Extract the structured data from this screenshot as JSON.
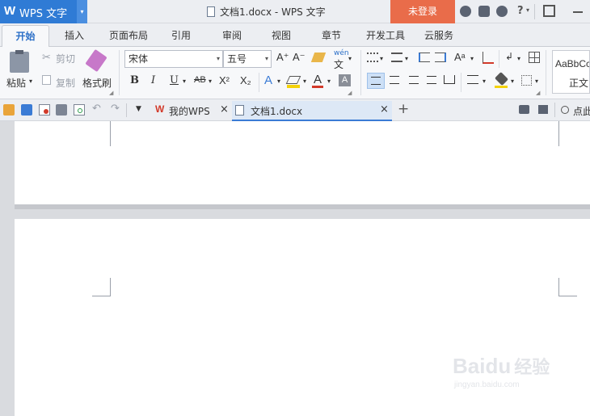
{
  "app": {
    "logo_letter": "W",
    "app_label": "WPS 文字",
    "dropdown_glyph": "▾"
  },
  "window": {
    "title": "文档1.docx - WPS 文字",
    "login_label": "未登录"
  },
  "title_icons": [
    "skin-icon",
    "settings-icon",
    "tools-icon",
    "help-icon",
    "restore-icon",
    "minimize-icon"
  ],
  "help_label": "?",
  "ribbon_tabs": [
    {
      "label": "开始",
      "active": true
    },
    {
      "label": "插入"
    },
    {
      "label": "页面布局"
    },
    {
      "label": "引用"
    },
    {
      "label": "审阅"
    },
    {
      "label": "视图"
    },
    {
      "label": "章节"
    },
    {
      "label": "开发工具"
    },
    {
      "label": "云服务"
    }
  ],
  "clipboard": {
    "paste": "粘贴",
    "cut": "剪切",
    "copy": "复制",
    "format_painter": "格式刷"
  },
  "font": {
    "name": "宋体",
    "size": "五号",
    "grow_label": "A⁺",
    "shrink_label": "A⁻"
  },
  "format_labels": {
    "bold": "B",
    "italic": "I",
    "underline": "U",
    "strike": "AB",
    "superscript": "X²",
    "subscript": "X₂",
    "text_effect": "A",
    "font_color": "A",
    "char_shading": "A",
    "phonetic": "wén"
  },
  "styles": {
    "preview_text": "AaBbCc",
    "normal_label": "正文"
  },
  "colors": {
    "accent_blue": "#2f7bd5",
    "login_orange": "#e96c4a",
    "font_color_red": "#d23a2a",
    "highlight_yellow": "#f4d20a"
  },
  "doc_tabs": [
    {
      "label": "我的WPS",
      "icon": "wps-logo-icon",
      "close": "×"
    },
    {
      "label": "文档1.docx",
      "icon": "document-icon",
      "close": "×",
      "active": true
    }
  ],
  "new_tab_glyph": "+",
  "search": {
    "label": "点此"
  },
  "watermark": {
    "brand": "Baidu",
    "brand_cn": "经验",
    "url": "jingyan.baidu.com"
  }
}
